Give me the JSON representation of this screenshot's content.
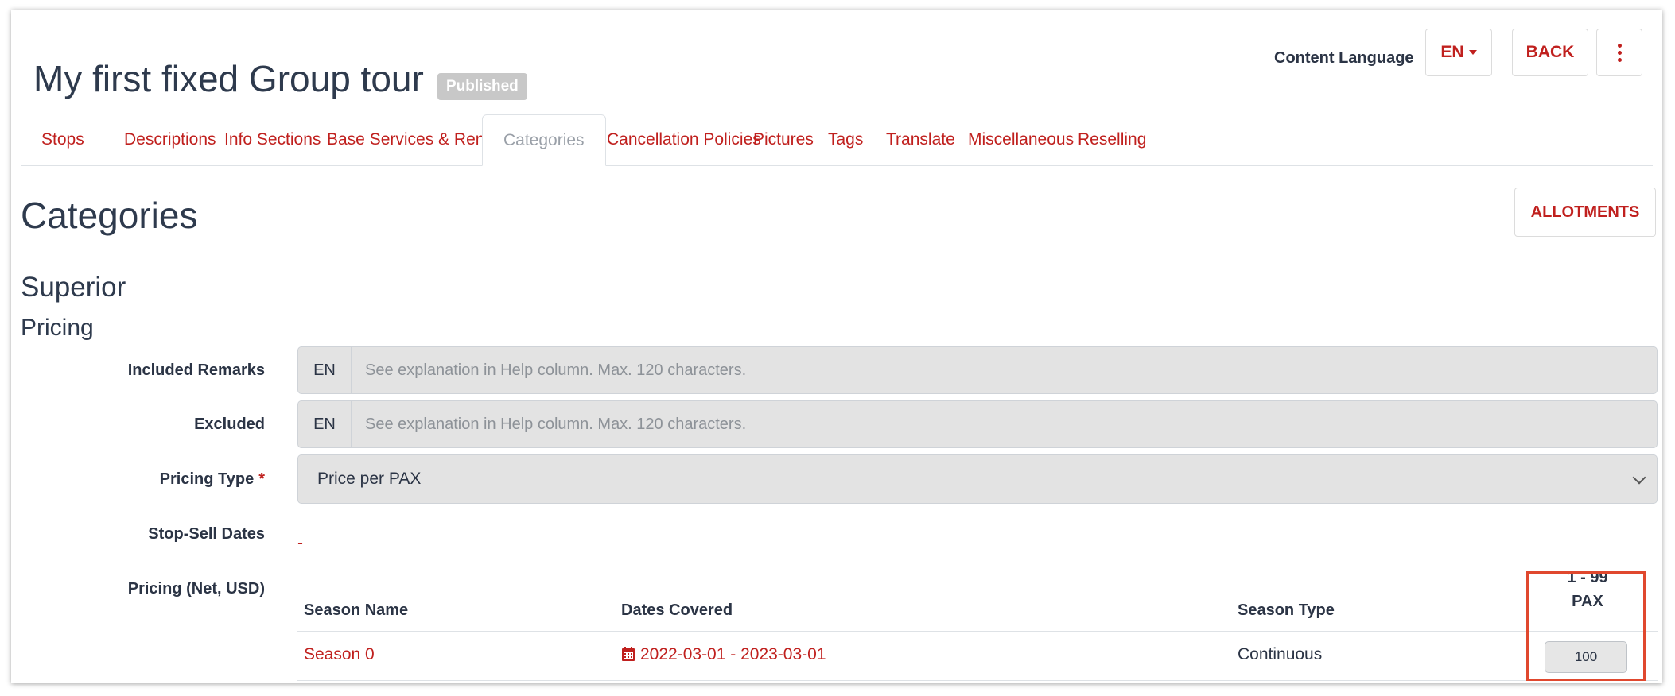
{
  "header": {
    "title": "My first fixed Group tour",
    "status_badge": "Published",
    "content_language_label": "Content Language",
    "language_button": "EN",
    "back_button": "BACK"
  },
  "tabs": [
    {
      "label": "Stops",
      "active": false
    },
    {
      "label": "Descriptions",
      "active": false
    },
    {
      "label": "Info Sections",
      "active": false
    },
    {
      "label": "Base Services & Rental Cars",
      "active": false
    },
    {
      "label": "Categories",
      "active": true
    },
    {
      "label": "Cancellation Policies",
      "active": false
    },
    {
      "label": "Pictures",
      "active": false
    },
    {
      "label": "Tags",
      "active": false
    },
    {
      "label": "Translate",
      "active": false
    },
    {
      "label": "Miscellaneous",
      "active": false
    },
    {
      "label": "Reselling",
      "active": false
    }
  ],
  "page": {
    "heading": "Categories",
    "allotments_button": "ALLOTMENTS",
    "category_name": "Superior",
    "section_heading": "Pricing"
  },
  "form": {
    "included_remarks": {
      "label": "Included Remarks",
      "lang": "EN",
      "placeholder": "See explanation in Help column. Max. 120 characters."
    },
    "excluded": {
      "label": "Excluded",
      "lang": "EN",
      "placeholder": "See explanation in Help column. Max. 120 characters."
    },
    "pricing_type": {
      "label": "Pricing Type",
      "required_mark": "*",
      "value": "Price per PAX"
    },
    "stop_sell_dates": {
      "label": "Stop-Sell Dates",
      "value": "-"
    },
    "pricing_label": "Pricing (Net, USD)"
  },
  "pricing_table": {
    "columns": [
      "Season Name",
      "Dates Covered",
      "Season Type"
    ],
    "pax_header_line1": "1 - 99",
    "pax_header_line2": "PAX",
    "rows": [
      {
        "season_name": "Season 0",
        "dates_covered": "2022-03-01 - 2023-03-01",
        "season_type": "Continuous",
        "price": "100"
      }
    ]
  },
  "colors": {
    "accent": "#c0201e",
    "highlight": "#e0482e",
    "badge": "#c8c8c8"
  },
  "icons": [
    "caret-down-icon",
    "more-vertical-icon",
    "chevron-down-icon",
    "calendar-icon"
  ]
}
